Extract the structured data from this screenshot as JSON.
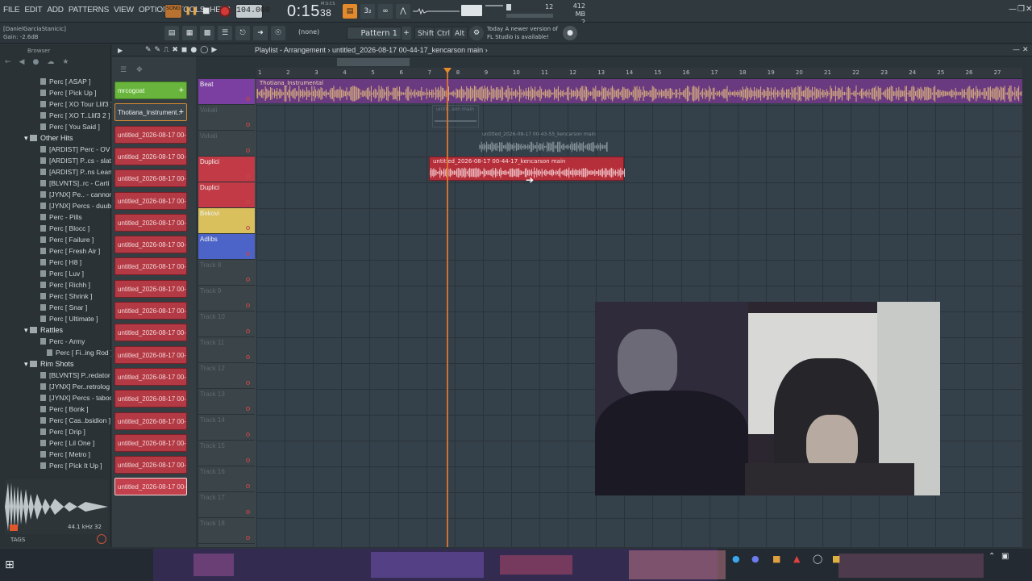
{
  "menu": [
    "FILE",
    "EDIT",
    "ADD",
    "PATTERNS",
    "VIEW",
    "OPTIONS",
    "TOOLS",
    "HELP"
  ],
  "transport": {
    "song_label": "SONG",
    "tempo": "104.000",
    "time_main": "0:15",
    "time_sub": "38",
    "time_unit": "M:S:CS"
  },
  "monitor": {
    "cpu_value": "12",
    "memory": "412 MB",
    "polyphony": "2"
  },
  "hint": {
    "line1": "[DanielGarciaStanicic]",
    "line2": "Gain: -2.6dB"
  },
  "toolbar2": {
    "pattern_none": "(none)",
    "pattern_label": "Pattern 1",
    "shift": "Shift",
    "ctrl": "Ctrl",
    "alt": "Alt",
    "news_line1": "Today  A newer version of",
    "news_line2": "FL Studio is available!"
  },
  "browser": {
    "title": "Browser",
    "items": [
      {
        "label": "Perc [ ASAP ]",
        "type": "file",
        "indent": 50
      },
      {
        "label": "Perc [ Pick Up ]",
        "type": "file",
        "indent": 50
      },
      {
        "label": "Perc [ XO Tour Llif3 ]",
        "type": "file",
        "indent": 50
      },
      {
        "label": "Perc [ XO T..Llif3 2 ]",
        "type": "file",
        "indent": 50
      },
      {
        "label": "Perc [ You Said ]",
        "type": "file",
        "indent": 50
      },
      {
        "label": "Other Hits",
        "type": "folder",
        "indent": 40
      },
      {
        "label": "[ARDIST] Perc - OV",
        "type": "file",
        "indent": 50
      },
      {
        "label": "[ARDIST] P..cs - slatt",
        "type": "file",
        "indent": 50
      },
      {
        "label": "[ARDIST] P..ns Lean",
        "type": "file",
        "indent": 50
      },
      {
        "label": "[BLVNTS]..rc - Carti",
        "type": "file",
        "indent": 50
      },
      {
        "label": "[JYNX] Pe.. - cannon",
        "type": "file",
        "indent": 50
      },
      {
        "label": "[JYNX] Percs - duubi",
        "type": "file",
        "indent": 50
      },
      {
        "label": "Perc - Pills",
        "type": "file",
        "indent": 50
      },
      {
        "label": "Perc [ Blocc ]",
        "type": "file",
        "indent": 50
      },
      {
        "label": "Perc [ Failure ]",
        "type": "file",
        "indent": 50
      },
      {
        "label": "Perc [ Fresh Air ]",
        "type": "file",
        "indent": 50
      },
      {
        "label": "Perc [ H8 ]",
        "type": "file",
        "indent": 50
      },
      {
        "label": "Perc [ Luv ]",
        "type": "file",
        "indent": 50
      },
      {
        "label": "Perc [ Richh ]",
        "type": "file",
        "indent": 50
      },
      {
        "label": "Perc [ Shrink ]",
        "type": "file",
        "indent": 50
      },
      {
        "label": "Perc [ Snar ]",
        "type": "file",
        "indent": 50
      },
      {
        "label": "Perc [ Ultimate ]",
        "type": "file",
        "indent": 50
      },
      {
        "label": "Rattles",
        "type": "folder",
        "indent": 40
      },
      {
        "label": "Perc - Army",
        "type": "file",
        "indent": 50
      },
      {
        "label": "Perc [ Fi..ing Rod ]",
        "type": "file",
        "indent": 58
      },
      {
        "label": "Rim Shots",
        "type": "folder",
        "indent": 40
      },
      {
        "label": "[BLVNTS] P..redator",
        "type": "file",
        "indent": 50
      },
      {
        "label": "[JYNX] Per..retrolog",
        "type": "file",
        "indent": 50
      },
      {
        "label": "[JYNX] Percs - taboo",
        "type": "file",
        "indent": 50
      },
      {
        "label": "Perc [ Bonk ]",
        "type": "file",
        "indent": 50
      },
      {
        "label": "Perc [ Cas..bsidion ]",
        "type": "file",
        "indent": 50
      },
      {
        "label": "Perc [ Drip ]",
        "type": "file",
        "indent": 50
      },
      {
        "label": "Perc [ Lil One ]",
        "type": "file",
        "indent": 50
      },
      {
        "label": "Perc [ Metro ]",
        "type": "file",
        "indent": 50
      },
      {
        "label": "Perc [ Pick It Up ]",
        "type": "file",
        "indent": 50
      }
    ],
    "sample_info": "44.1 kHz 32",
    "tags_label": "TAGS"
  },
  "channels": [
    {
      "label": "mrcogoat",
      "style": "green"
    },
    {
      "label": "Thotiana_Instrument..",
      "style": "orange"
    },
    {
      "label": "untitled_2026-08-17 00-..",
      "style": "red"
    },
    {
      "label": "untitled_2026-08-17 00-..",
      "style": "red"
    },
    {
      "label": "untitled_2026-08-17 00-..",
      "style": "red"
    },
    {
      "label": "untitled_2026-08-17 00-..",
      "style": "red"
    },
    {
      "label": "untitled_2026-08-17 00-..",
      "style": "red"
    },
    {
      "label": "untitled_2026-08-17 00-..",
      "style": "red"
    },
    {
      "label": "untitled_2026-08-17 00-..",
      "style": "red"
    },
    {
      "label": "untitled_2026-08-17 00-..",
      "style": "red"
    },
    {
      "label": "untitled_2026-08-17 00-..",
      "style": "red"
    },
    {
      "label": "untitled_2026-08-17 00-..",
      "style": "red"
    },
    {
      "label": "untitled_2026-08-17 00-..",
      "style": "red"
    },
    {
      "label": "untitled_2026-08-17 00-..",
      "style": "red"
    },
    {
      "label": "untitled_2026-08-17 00-..",
      "style": "red"
    },
    {
      "label": "untitled_2026-08-17 00-..",
      "style": "red"
    },
    {
      "label": "untitled_2026-08-17 00-..",
      "style": "red"
    },
    {
      "label": "untitled_2026-08-17 00-..",
      "style": "red"
    },
    {
      "label": "untitled_2026-08-17 00-..",
      "style": "sel"
    }
  ],
  "playlist": {
    "title_prefix": "Playlist - Arrangement",
    "title_name": "untitled_2026-08-17 00-44-17_kencarson main",
    "ruler": [
      "1",
      "2",
      "3",
      "4",
      "5",
      "6",
      "7",
      "8",
      "9",
      "10",
      "11",
      "12",
      "13",
      "14",
      "15",
      "16",
      "17",
      "18",
      "19",
      "20",
      "21",
      "22",
      "23",
      "24",
      "25",
      "26",
      "27"
    ],
    "tracks": [
      {
        "label": "Beat",
        "color": "#7a3fa0"
      },
      {
        "label": "Vokali",
        "color": ""
      },
      {
        "label": "Vokali",
        "color": ""
      },
      {
        "label": "Duplici",
        "color": "#c23a45"
      },
      {
        "label": "Duplici",
        "color": "#c23a45"
      },
      {
        "label": "Bekovi",
        "color": "#d9c05c"
      },
      {
        "label": "Adlibs",
        "color": "#4c63c8"
      },
      {
        "label": "Track 8",
        "color": ""
      },
      {
        "label": "Track 9",
        "color": ""
      },
      {
        "label": "Track 10",
        "color": ""
      },
      {
        "label": "Track 11",
        "color": ""
      },
      {
        "label": "Track 12",
        "color": ""
      },
      {
        "label": "Track 13",
        "color": ""
      },
      {
        "label": "Track 14",
        "color": ""
      },
      {
        "label": "Track 15",
        "color": ""
      },
      {
        "label": "Track 16",
        "color": ""
      },
      {
        "label": "Track 17",
        "color": ""
      },
      {
        "label": "Track 18",
        "color": ""
      }
    ],
    "clips": {
      "beat": "Thotiana_Instrumental",
      "vocal_small": "untitl..son main",
      "vocal_mid": "untitled_2026-08-17 00-43-55_kencarson main",
      "main": "untitled_2026-08-17 00-44-17_kencarson main"
    }
  },
  "colors": {
    "accent": "#e58a2c",
    "beat_clip": "#d9b07e",
    "selected_clip": "#c2343e"
  }
}
